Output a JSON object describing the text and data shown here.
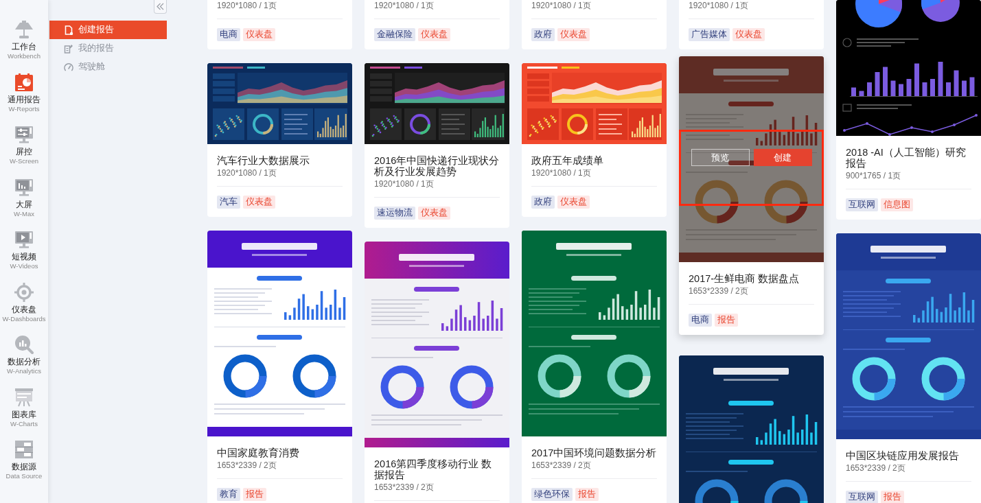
{
  "sidebar": {
    "items": [
      {
        "label": "工作台",
        "sublabel": "Workbench",
        "selected": false
      },
      {
        "label": "通用报告",
        "sublabel": "W-Reports",
        "selected": true
      },
      {
        "label": "屏控",
        "sublabel": "W-Screen",
        "selected": false
      },
      {
        "label": "大屏",
        "sublabel": "W-Max",
        "selected": false
      },
      {
        "label": "短视频",
        "sublabel": "W-Videos",
        "selected": false
      },
      {
        "label": "仪表盘",
        "sublabel": "W-Dashboards",
        "selected": false
      },
      {
        "label": "数据分析",
        "sublabel": "W-Analytics",
        "selected": false
      },
      {
        "label": "图表库",
        "sublabel": "W-Charts",
        "selected": false
      },
      {
        "label": "数据源",
        "sublabel": "Data Source",
        "selected": false
      }
    ]
  },
  "submenu": {
    "items": [
      {
        "label": "创建报告",
        "selected": true
      },
      {
        "label": "我的报告",
        "selected": false
      },
      {
        "label": "驾驶舱",
        "selected": false
      }
    ]
  },
  "gallery": {
    "columns": [
      {
        "cards": [
          {
            "meta": "1920*1080 / 1页",
            "tags": [
              {
                "label": "电商",
                "kind": "category"
              },
              {
                "label": "仪表盘",
                "kind": "type"
              }
            ],
            "hovered": false
          },
          {
            "preview": {
              "kind": "dashboard",
              "color": "#0b2b5c"
            },
            "title": "汽车行业大数据展示",
            "meta": "1920*1080 / 1页",
            "tags": [
              {
                "label": "汽车",
                "kind": "category"
              },
              {
                "label": "仪表盘",
                "kind": "type"
              }
            ],
            "hovered": false
          },
          {
            "preview": {
              "kind": "report",
              "color": "#4a14cc"
            },
            "title": "中国家庭教育消费",
            "meta": "1653*2339 / 2页",
            "tags": [
              {
                "label": "教育",
                "kind": "category"
              },
              {
                "label": "报告",
                "kind": "type"
              }
            ],
            "hovered": false
          }
        ]
      },
      {
        "cards": [
          {
            "meta": "1920*1080 / 1页",
            "tags": [
              {
                "label": "金融保险",
                "kind": "category"
              },
              {
                "label": "仪表盘",
                "kind": "type"
              }
            ],
            "hovered": false
          },
          {
            "preview": {
              "kind": "dashboard",
              "color": "#161616"
            },
            "title": "2016年中国快递行业现状分析及行业发展趋势",
            "meta": "1920*1080 / 1页",
            "tags": [
              {
                "label": "速运物流",
                "kind": "category"
              },
              {
                "label": "仪表盘",
                "kind": "type"
              }
            ],
            "hovered": false
          },
          {
            "preview": {
              "kind": "report",
              "color": "#b01c8e"
            },
            "title": "2016第四季度移动行业 数据报告",
            "meta": "1653*2339 / 2页",
            "hovered": false
          }
        ]
      },
      {
        "cards": [
          {
            "meta": "1920*1080 / 1页",
            "tags": [
              {
                "label": "政府",
                "kind": "category"
              },
              {
                "label": "仪表盘",
                "kind": "type"
              }
            ],
            "hovered": false
          },
          {
            "preview": {
              "kind": "dashboard",
              "color": "#f24a2e"
            },
            "title": "政府五年成绩单",
            "meta": "1920*1080 / 1页",
            "tags": [
              {
                "label": "政府",
                "kind": "category"
              },
              {
                "label": "仪表盘",
                "kind": "type"
              }
            ],
            "hovered": false
          },
          {
            "preview": {
              "kind": "report",
              "color": "#006a3c"
            },
            "title": "2017中国环境问题数据分析",
            "meta": "1653*2339 / 2页",
            "tags": [
              {
                "label": "绿色环保",
                "kind": "category"
              },
              {
                "label": "报告",
                "kind": "type"
              }
            ],
            "hovered": false
          }
        ]
      },
      {
        "cards": [
          {
            "meta": "1920*1080 / 1页",
            "tags": [
              {
                "label": "广告媒体",
                "kind": "category"
              },
              {
                "label": "仪表盘",
                "kind": "type"
              }
            ],
            "hovered": false
          },
          {
            "preview": {
              "kind": "report",
              "color": "#5e2c24"
            },
            "title": "2017-生鲜电商 数据盘点",
            "meta": "1653*2339 / 2页",
            "tags": [
              {
                "label": "电商",
                "kind": "category"
              },
              {
                "label": "报告",
                "kind": "type"
              }
            ],
            "hovered": true,
            "overlay": {
              "highlighted": true,
              "buttons": [
                {
                  "label": "预览",
                  "kind": "outline"
                },
                {
                  "label": "创建",
                  "kind": "primary"
                }
              ]
            }
          },
          {
            "preview": {
              "kind": "report",
              "color": "#0b2750"
            },
            "hovered": false
          }
        ]
      },
      {
        "cards": [
          {
            "preview": {
              "kind": "infographic",
              "color": "#000000"
            },
            "title": "2018 -AI（人工智能）研究报告",
            "meta": "900*1765 / 1页",
            "tags": [
              {
                "label": "互联网",
                "kind": "category"
              },
              {
                "label": "信息图",
                "kind": "type"
              }
            ],
            "hovered": false
          },
          {
            "preview": {
              "kind": "report",
              "color": "#1e3a94"
            },
            "title": "中国区块链应用发展报告",
            "meta": "1653*2339 / 2页",
            "tags": [
              {
                "label": "互联网",
                "kind": "category"
              },
              {
                "label": "报告",
                "kind": "type"
              }
            ],
            "hovered": false
          }
        ]
      }
    ]
  }
}
